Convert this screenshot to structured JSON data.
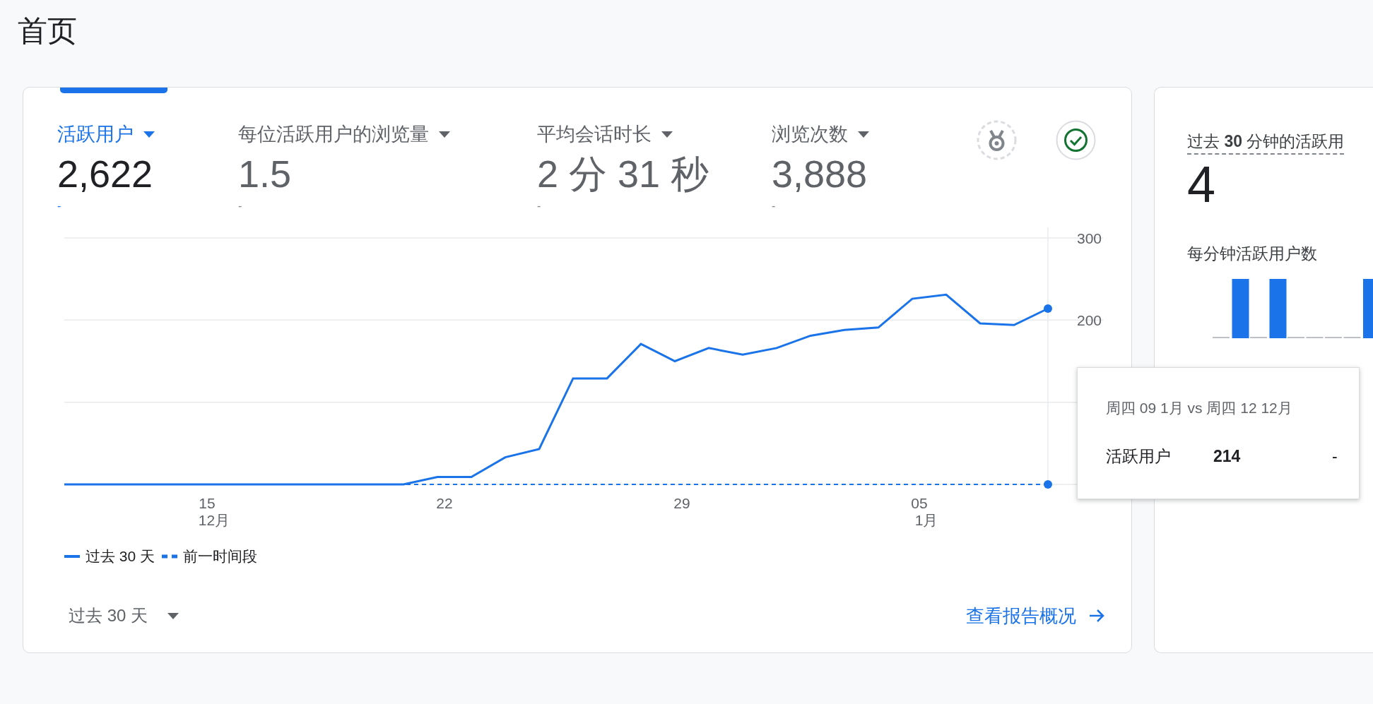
{
  "page_title": "首页",
  "overview_card": {
    "metrics": [
      {
        "label": "活跃用户",
        "value": "2,622",
        "change": "-",
        "selected": true
      },
      {
        "label": "每位活跃用户的浏览量",
        "value": "1.5",
        "change": "-",
        "selected": false
      },
      {
        "label": "平均会话时长",
        "value": "2 分 31 秒",
        "change": "-",
        "selected": false
      },
      {
        "label": "浏览次数",
        "value": "3,888",
        "change": "-",
        "selected": false
      }
    ],
    "chart_data": {
      "type": "line",
      "ylim": [
        0,
        300
      ],
      "yticks": [
        {
          "value": 200,
          "label": "200"
        },
        {
          "value": 300,
          "label": "300"
        }
      ],
      "series": [
        {
          "name": "过去 30 天",
          "color": "#1a73e8",
          "line_style": "solid",
          "values": [
            0,
            0,
            0,
            0,
            0,
            0,
            0,
            0,
            0,
            0,
            0,
            9,
            9,
            33,
            43,
            129,
            129,
            171,
            150,
            166,
            158,
            166,
            181,
            188,
            191,
            226,
            231,
            196,
            194,
            214
          ]
        },
        {
          "name": "前一时间段",
          "color": "#1a73e8",
          "line_style": "dashed",
          "values": [
            0,
            0,
            0,
            0,
            0,
            0,
            0,
            0,
            0,
            0,
            0,
            0,
            0,
            0,
            0,
            0,
            0,
            0,
            0,
            0,
            0,
            0,
            0,
            0,
            0,
            0,
            0,
            0,
            0,
            0
          ]
        }
      ]
    },
    "x_axis_labels": [
      {
        "day": "15",
        "month": "12月"
      },
      {
        "day": "22"
      },
      {
        "day": "29"
      },
      {
        "day": "05",
        "month": "1月"
      }
    ],
    "date_range": "过去 30 天",
    "report_link": "查看报告概况"
  },
  "tooltip": {
    "title": "周四 09 1月 vs 周四 12 12月",
    "metric": "活跃用户",
    "value": "214",
    "comparison": "-"
  },
  "realtime_card": {
    "title": "过去 **30** 分钟的活跃用",
    "value": "4",
    "chart_title": "每分钟活跃用户数"
  }
}
